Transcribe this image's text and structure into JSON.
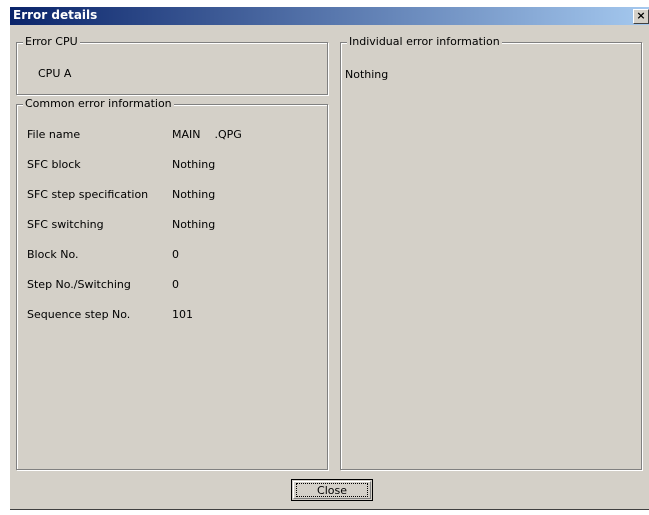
{
  "window": {
    "title": "Error details",
    "close_glyph": "×",
    "close_icon": "close-icon"
  },
  "error_cpu": {
    "legend": "Error CPU",
    "value": "CPU A"
  },
  "common": {
    "legend": "Common error information",
    "rows": [
      {
        "label": "File name",
        "value": "MAIN    .QPG"
      },
      {
        "label": "SFC block",
        "value": "Nothing"
      },
      {
        "label": "SFC step specification",
        "value": "Nothing"
      },
      {
        "label": "SFC switching",
        "value": "Nothing"
      },
      {
        "label": "Block No.",
        "value": "0"
      },
      {
        "label": "Step No./Switching",
        "value": "0"
      },
      {
        "label": "Sequence step No.",
        "value": "101"
      }
    ]
  },
  "individual": {
    "legend": "Individual error information",
    "value": "Nothing"
  },
  "footer": {
    "close_label": "Close"
  }
}
